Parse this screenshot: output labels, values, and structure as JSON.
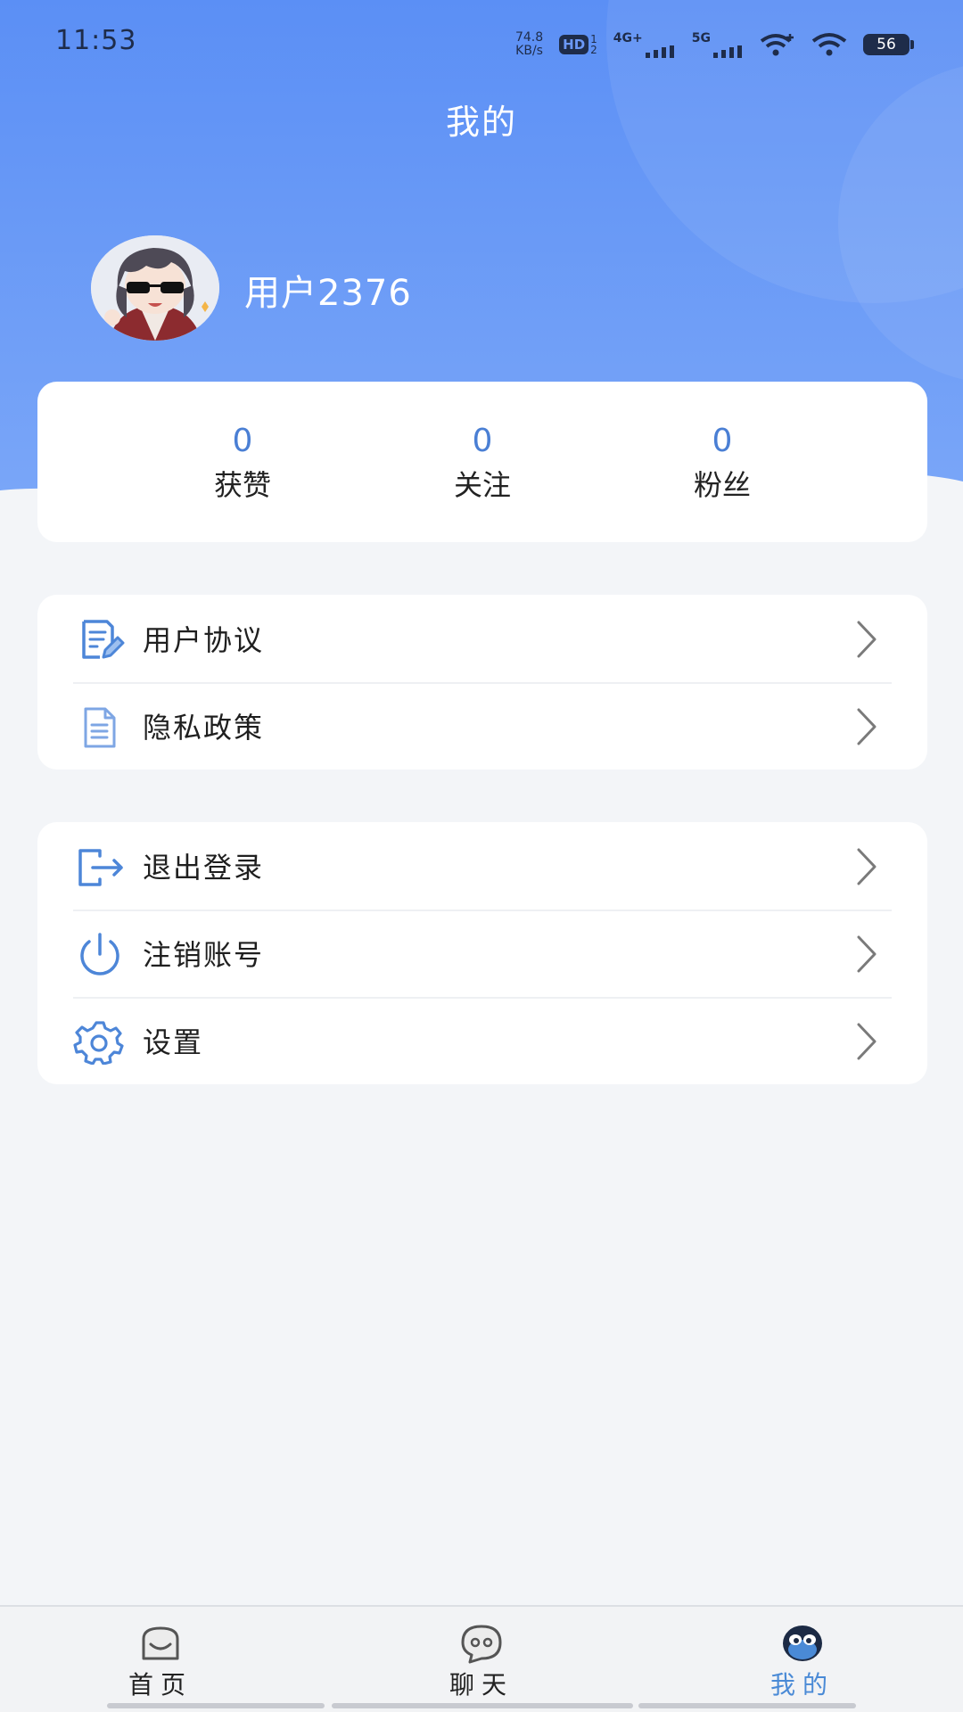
{
  "status_bar": {
    "time": "11:53",
    "net_speed_value": "74.8",
    "net_speed_unit": "KB/s",
    "hd_label": "HD",
    "hd_sub_top": "1",
    "hd_sub_bottom": "2",
    "signal1_label": "4G+",
    "signal2_label": "5G",
    "battery_level": "56"
  },
  "header": {
    "title": "我的"
  },
  "profile": {
    "username": "用户2376"
  },
  "stats": [
    {
      "value": "0",
      "label": "获赞"
    },
    {
      "value": "0",
      "label": "关注"
    },
    {
      "value": "0",
      "label": "粉丝"
    }
  ],
  "menu_group_1": [
    {
      "label": "用户协议",
      "icon": "agreement-icon"
    },
    {
      "label": "隐私政策",
      "icon": "document-icon"
    }
  ],
  "menu_group_2": [
    {
      "label": "退出登录",
      "icon": "logout-icon"
    },
    {
      "label": "注销账号",
      "icon": "power-icon"
    },
    {
      "label": "设置",
      "icon": "gear-icon"
    }
  ],
  "bottom_nav": {
    "items": [
      {
        "label": "首页",
        "icon": "home-face-icon",
        "active": false
      },
      {
        "label": "聊天",
        "icon": "chat-face-icon",
        "active": false
      },
      {
        "label": "我的",
        "icon": "profile-face-icon",
        "active": true
      }
    ]
  },
  "colors": {
    "header_gradient_top": "#5b8ff5",
    "header_gradient_bottom": "#7aa6f8",
    "accent": "#4a7fd4",
    "active_tab": "#4a8ad6",
    "page_bg": "#f3f5f8"
  }
}
